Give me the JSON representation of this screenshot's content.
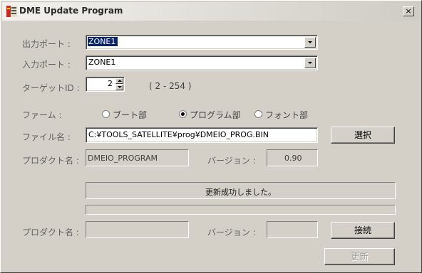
{
  "window": {
    "title": "DME Update Program",
    "close_glyph": "×"
  },
  "form": {
    "output_port": {
      "label": "出力ポート :",
      "value": "ZONE1"
    },
    "input_port": {
      "label": "入力ポート :",
      "value": "ZONE1"
    },
    "target_id": {
      "label": "ターゲットID :",
      "value": "2",
      "range": "( 2 - 254 )"
    },
    "firmware": {
      "label": "ファーム :",
      "options": [
        {
          "label": "ブート部",
          "checked": false
        },
        {
          "label": "プログラム部",
          "checked": true
        },
        {
          "label": "フォント部",
          "checked": false
        }
      ]
    },
    "file_name": {
      "label": "ファイル名 :",
      "value": "C:¥TOOLS_SATELLITE¥prog¥DMEIO_PROG.BIN"
    },
    "select_button": "選択",
    "product_name_1": {
      "label": "プロダクト名 :",
      "value": "DMEIO_PROGRAM"
    },
    "version_1": {
      "label": "バージョン :",
      "value": "0.90"
    },
    "status_message": "更新成功しました。",
    "progress": 0,
    "product_name_2": {
      "label": "プロダクト名 :",
      "value": ""
    },
    "version_2": {
      "label": "バージョン :",
      "value": ""
    },
    "connect_button": "接続",
    "update_button": "更新"
  },
  "icons": {
    "app": "app-icon",
    "close": "close-icon",
    "dropdown": "chevron-down-icon",
    "spin_up": "spin-up-icon",
    "spin_down": "spin-down-icon"
  },
  "colors": {
    "face": "#d4d0c8",
    "selection": "#0a246a"
  }
}
